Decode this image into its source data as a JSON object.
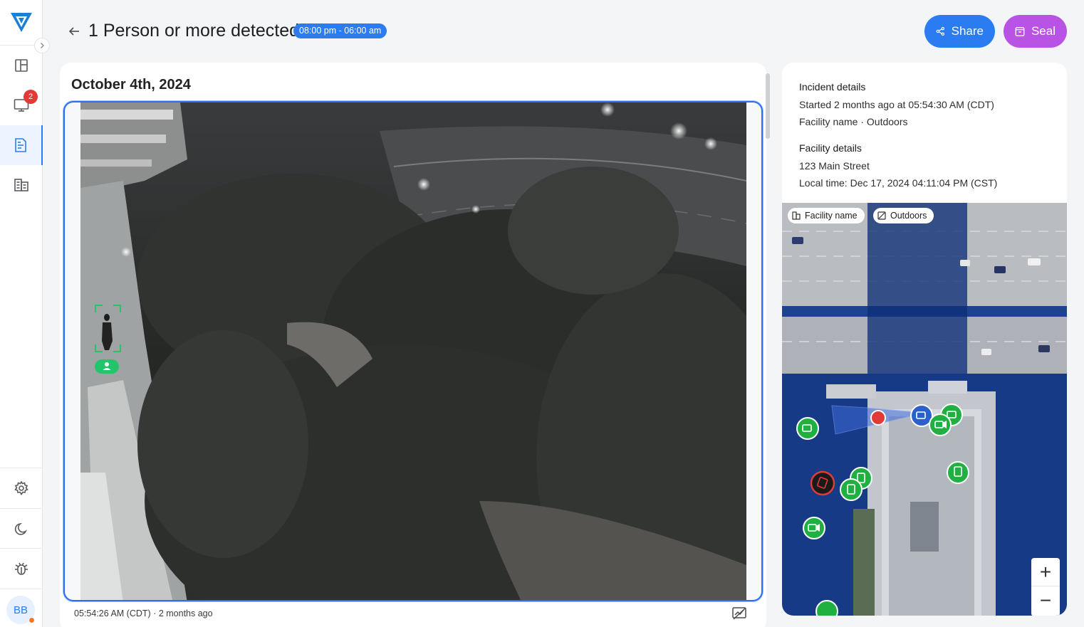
{
  "header": {
    "title": "1 Person or more detected",
    "time_range": "08:00 pm - 06:00 am",
    "share_label": "Share",
    "seal_label": "Seal"
  },
  "sidebar": {
    "items": [
      {
        "icon": "layout-icon"
      },
      {
        "icon": "monitor-icon",
        "badge": "2"
      },
      {
        "icon": "report-icon",
        "active": true
      },
      {
        "icon": "building-icon"
      }
    ],
    "bottom_items": [
      {
        "icon": "gear-icon"
      },
      {
        "icon": "moon-icon"
      },
      {
        "icon": "bug-icon"
      }
    ],
    "avatar_initials": "BB",
    "accent_color": "#2b7cf0"
  },
  "feed": {
    "date": "October 4th, 2024",
    "timestamp": "05:54:26 AM (CDT)",
    "separator": "·",
    "relative": "2 months ago",
    "detection_icon": "person-icon"
  },
  "incident": {
    "heading": "Incident details",
    "started": "Started 2 months ago at 05:54:30 AM (CDT)",
    "location": "Facility name · Outdoors"
  },
  "facility": {
    "heading": "Facility details",
    "address": "123 Main Street",
    "local_time": "Local time: Dec 17, 2024 04:11:04 PM (CST)"
  },
  "map": {
    "chips": [
      "Facility name",
      "Outdoors"
    ],
    "zoom_in": "+",
    "zoom_out": "−"
  },
  "colors": {
    "primary": "#2b7cf0",
    "seal": "#b953e6",
    "camera_marker": "#1fb041",
    "alert_marker": "#e23a36",
    "badge": "#e23a36"
  }
}
